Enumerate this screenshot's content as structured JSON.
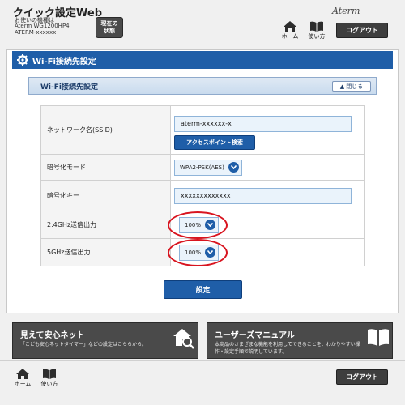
{
  "header": {
    "title": "クイック設定Web",
    "device_label": "お使いの機種は",
    "device_model": "Aterm WG1200HP4",
    "device_name": "ATERM-xxxxxx",
    "status_button_line1": "現在の",
    "status_button_line2": "状態",
    "home_label": "ホーム",
    "help_label": "使い方",
    "brand": "Aterm",
    "logout_label": "ログアウト"
  },
  "main": {
    "section_title": "Wi-Fi接続先設定",
    "subsection_title": "Wi-Fi接続先設定",
    "collapse_label": "閉じる",
    "fields": {
      "ssid_label": "ネットワーク名(SSID)",
      "ssid_value": "aterm-xxxxxx-x",
      "ap_search_label": "アクセスポイント検索",
      "enc_mode_label": "暗号化モード",
      "enc_mode_value": "WPA2-PSK(AES)",
      "enc_key_label": "暗号化キー",
      "enc_key_value": "xxxxxxxxxxxxx",
      "power24_label": "2.4GHz送信出力",
      "power24_value": "100%",
      "power5_label": "5GHz送信出力",
      "power5_value": "100%"
    },
    "submit_label": "設定"
  },
  "cards": {
    "safety_title": "見えて安心ネット",
    "safety_desc": "「こども安心ネットタイマー」などの設定はこちらから。",
    "manual_title": "ユーザーズマニュアル",
    "manual_desc_line1": "本商品のさまざまな機能を利用してできることを、わかりやすい操",
    "manual_desc_line2": "作・設定手順で説明しています。"
  },
  "footer": {
    "home_label": "ホーム",
    "help_label": "使い方",
    "logout_label": "ログアウト"
  },
  "colors": {
    "accent_blue": "#1f5ea8",
    "highlight_red": "#d8141f",
    "dark_button": "#3e3e3e"
  }
}
